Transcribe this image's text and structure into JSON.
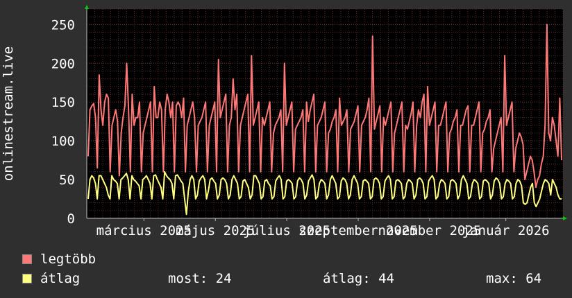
{
  "chart_data": {
    "type": "line",
    "ylabel": "onlinestream.live",
    "ylim": [
      0,
      270
    ],
    "yticks": [
      0,
      50,
      100,
      150,
      200,
      250
    ],
    "x_ticks": [
      {
        "label": "március 2025",
        "pos": 0.12
      },
      {
        "label": "május 2025",
        "pos": 0.27
      },
      {
        "label": "július 2025",
        "pos": 0.42
      },
      {
        "label": "szeptember 2025",
        "pos": 0.57
      },
      {
        "label": "november 2025",
        "pos": 0.72
      },
      {
        "label": "január 2026",
        "pos": 0.88
      }
    ],
    "grid": true,
    "background": "#000000",
    "grid_color": "#5a2a2a",
    "series": [
      {
        "name": "legtöbb",
        "color": "#ff7878",
        "values": [
          80,
          140,
          145,
          148,
          130,
          65,
          185,
          140,
          120,
          150,
          160,
          155,
          60,
          120,
          130,
          140,
          125,
          55,
          110,
          130,
          145,
          200,
          140,
          60,
          160,
          120,
          130,
          130,
          150,
          60,
          110,
          120,
          130,
          140,
          150,
          60,
          170,
          130,
          130,
          150,
          140,
          60,
          140,
          160,
          150,
          130,
          150,
          60,
          145,
          150,
          145,
          130,
          155,
          60,
          120,
          130,
          140,
          150,
          130,
          60,
          120,
          125,
          130,
          140,
          150,
          60,
          120,
          130,
          140,
          150,
          60,
          205,
          130,
          140,
          150,
          160,
          60,
          120,
          130,
          180,
          140,
          160,
          60,
          120,
          130,
          140,
          150,
          160,
          60,
          210,
          120,
          130,
          140,
          150,
          60,
          130,
          120,
          130,
          140,
          150,
          60,
          110,
          120,
          125,
          130,
          140,
          60,
          200,
          120,
          130,
          140,
          150,
          60,
          115,
          120,
          125,
          130,
          140,
          60,
          150,
          125,
          140,
          150,
          160,
          60,
          120,
          125,
          130,
          140,
          150,
          60,
          110,
          115,
          125,
          130,
          140,
          60,
          155,
          120,
          125,
          130,
          140,
          60,
          115,
          120,
          125,
          135,
          145,
          60,
          120,
          125,
          130,
          140,
          155,
          60,
          235,
          115,
          125,
          135,
          145,
          60,
          130,
          120,
          130,
          140,
          150,
          60,
          110,
          120,
          130,
          140,
          150,
          60,
          120,
          115,
          125,
          135,
          150,
          60,
          120,
          140,
          130,
          150,
          160,
          60,
          170,
          120,
          130,
          140,
          150,
          60,
          120,
          120,
          130,
          140,
          150,
          60,
          110,
          115,
          125,
          130,
          140,
          60,
          120,
          120,
          130,
          140,
          145,
          60,
          120,
          120,
          130,
          140,
          150,
          60,
          110,
          115,
          125,
          130,
          140,
          60,
          90,
          100,
          110,
          120,
          130,
          60,
          210,
          120,
          130,
          140,
          150,
          60,
          90,
          100,
          110,
          105,
          95,
          50,
          60,
          70,
          80,
          75,
          60,
          40,
          50,
          55,
          70,
          80,
          120,
          250,
          110,
          100,
          130,
          120,
          100,
          80,
          155,
          75
        ]
      },
      {
        "name": "átlag",
        "color": "#ffff80",
        "values": [
          25,
          50,
          55,
          52,
          45,
          25,
          55,
          55,
          50,
          45,
          40,
          30,
          25,
          55,
          50,
          48,
          45,
          25,
          50,
          52,
          55,
          58,
          50,
          25,
          55,
          50,
          48,
          45,
          42,
          25,
          50,
          52,
          55,
          50,
          45,
          25,
          55,
          56,
          50,
          45,
          40,
          25,
          60,
          55,
          52,
          50,
          45,
          25,
          55,
          56,
          52,
          48,
          45,
          25,
          5,
          35,
          50,
          55,
          50,
          25,
          30,
          48,
          52,
          55,
          50,
          25,
          35,
          50,
          52,
          48,
          45,
          25,
          30,
          50,
          52,
          50,
          45,
          25,
          30,
          50,
          55,
          50,
          45,
          25,
          28,
          48,
          50,
          45,
          40,
          25,
          30,
          55,
          55,
          50,
          45,
          25,
          28,
          48,
          50,
          45,
          42,
          25,
          28,
          48,
          52,
          55,
          50,
          25,
          28,
          48,
          50,
          48,
          45,
          25,
          28,
          48,
          52,
          50,
          45,
          25,
          30,
          48,
          52,
          56,
          50,
          25,
          28,
          45,
          50,
          48,
          45,
          25,
          30,
          50,
          55,
          50,
          45,
          25,
          28,
          48,
          52,
          50,
          45,
          25,
          30,
          50,
          55,
          50,
          45,
          25,
          28,
          48,
          50,
          48,
          45,
          25,
          28,
          50,
          52,
          50,
          45,
          25,
          28,
          48,
          52,
          55,
          50,
          25,
          28,
          48,
          50,
          48,
          45,
          25,
          28,
          45,
          50,
          48,
          45,
          25,
          30,
          50,
          52,
          50,
          45,
          25,
          28,
          48,
          52,
          55,
          50,
          25,
          28,
          45,
          50,
          48,
          45,
          25,
          28,
          48,
          50,
          48,
          45,
          25,
          30,
          50,
          55,
          50,
          45,
          25,
          28,
          45,
          50,
          48,
          45,
          25,
          28,
          48,
          50,
          48,
          45,
          25,
          30,
          48,
          52,
          50,
          45,
          25,
          28,
          45,
          50,
          48,
          45,
          25,
          28,
          45,
          50,
          48,
          42,
          20,
          18,
          20,
          30,
          40,
          45,
          20,
          15,
          20,
          25,
          35,
          45,
          50,
          48,
          45,
          30,
          50,
          45,
          40,
          30,
          25,
          25
        ]
      }
    ],
    "stats": {
      "most_label": "most:",
      "most": "24",
      "atlag_label": "átlag:",
      "atlag": "44",
      "max_label": "max:",
      "max": "64"
    }
  }
}
